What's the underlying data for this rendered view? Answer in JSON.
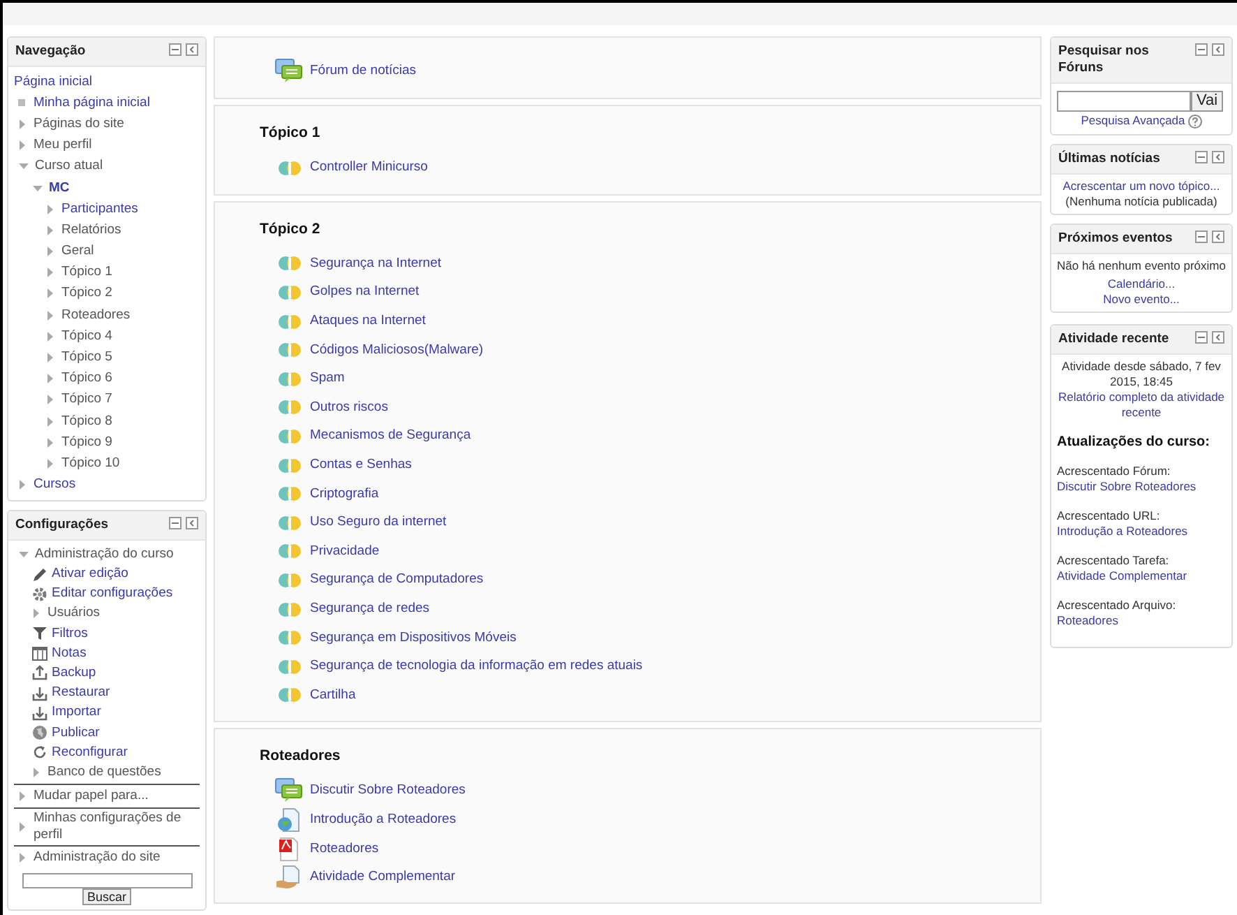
{
  "navigation": {
    "title": "Navegação",
    "items": [
      {
        "label": "Página inicial",
        "kind": "plain",
        "link": true
      },
      {
        "label": "Minha página inicial",
        "kind": "bullet",
        "link": true
      },
      {
        "label": "Páginas do site",
        "kind": "collapsed",
        "link": false
      },
      {
        "label": "Meu perfil",
        "kind": "collapsed",
        "link": false
      },
      {
        "label": "Curso atual",
        "kind": "expanded",
        "link": false,
        "children": [
          {
            "label": "MC",
            "kind": "course",
            "link": true,
            "children": [
              {
                "label": "Participantes",
                "kind": "collapsed",
                "link": true
              },
              {
                "label": "Relatórios",
                "kind": "collapsed",
                "link": false
              },
              {
                "label": "Geral",
                "kind": "collapsed",
                "link": false
              },
              {
                "label": "Tópico 1",
                "kind": "collapsed",
                "link": false
              },
              {
                "label": "Tópico 2",
                "kind": "collapsed",
                "link": false
              },
              {
                "label": "Roteadores",
                "kind": "collapsed",
                "link": false
              },
              {
                "label": "Tópico 4",
                "kind": "collapsed",
                "link": false
              },
              {
                "label": "Tópico 5",
                "kind": "collapsed",
                "link": false
              },
              {
                "label": "Tópico 6",
                "kind": "collapsed",
                "link": false
              },
              {
                "label": "Tópico 7",
                "kind": "collapsed",
                "link": false
              },
              {
                "label": "Tópico 8",
                "kind": "collapsed",
                "link": false
              },
              {
                "label": "Tópico 9",
                "kind": "collapsed",
                "link": false
              },
              {
                "label": "Tópico 10",
                "kind": "collapsed",
                "link": false
              }
            ]
          }
        ]
      },
      {
        "label": "Cursos",
        "kind": "collapsed",
        "link": true
      }
    ]
  },
  "settings": {
    "title": "Configurações",
    "groups": [
      {
        "label": "Administração do curso",
        "kind": "expanded",
        "link": false,
        "children": [
          {
            "label": "Ativar edição",
            "kind": "edit",
            "link": true
          },
          {
            "label": "Editar configurações",
            "kind": "settings",
            "link": true
          },
          {
            "label": "Usuários",
            "kind": "collapsed",
            "link": false
          },
          {
            "label": "Filtros",
            "kind": "filter",
            "link": true
          },
          {
            "label": "Notas",
            "kind": "grades",
            "link": true
          },
          {
            "label": "Backup",
            "kind": "upload",
            "link": true
          },
          {
            "label": "Restaurar",
            "kind": "download",
            "link": true
          },
          {
            "label": "Importar",
            "kind": "download",
            "link": true
          },
          {
            "label": "Publicar",
            "kind": "globe",
            "link": true
          },
          {
            "label": "Reconfigurar",
            "kind": "reset",
            "link": true
          },
          {
            "label": "Banco de questões",
            "kind": "collapsed",
            "link": false
          }
        ]
      },
      {
        "label": "Mudar papel para...",
        "kind": "collapsed",
        "link": false
      },
      {
        "label": "Minhas configurações de perfil",
        "kind": "collapsed",
        "link": false
      },
      {
        "label": "Administração do site",
        "kind": "collapsed",
        "link": false
      }
    ],
    "search_button": "Buscar"
  },
  "sections": [
    {
      "activities": [
        {
          "label": "Fórum de notícias",
          "kind": "forum"
        }
      ]
    },
    {
      "title": "Tópico 1",
      "activities": [
        {
          "label": "Controller Minicurso",
          "kind": "lesson"
        }
      ]
    },
    {
      "title": "Tópico 2",
      "activities": [
        {
          "label": "Segurança na Internet",
          "kind": "lesson"
        },
        {
          "label": "Golpes na Internet",
          "kind": "lesson"
        },
        {
          "label": "Ataques na Internet",
          "kind": "lesson"
        },
        {
          "label": "Códigos Maliciosos(Malware)",
          "kind": "lesson"
        },
        {
          "label": "Spam",
          "kind": "lesson"
        },
        {
          "label": "Outros riscos",
          "kind": "lesson"
        },
        {
          "label": "Mecanismos de Segurança",
          "kind": "lesson"
        },
        {
          "label": "Contas e Senhas",
          "kind": "lesson"
        },
        {
          "label": "Criptografia",
          "kind": "lesson"
        },
        {
          "label": "Uso Seguro da internet",
          "kind": "lesson"
        },
        {
          "label": "Privacidade",
          "kind": "lesson"
        },
        {
          "label": "Segurança de Computadores",
          "kind": "lesson"
        },
        {
          "label": "Segurança de redes",
          "kind": "lesson"
        },
        {
          "label": "Segurança em Dispositivos Móveis",
          "kind": "lesson"
        },
        {
          "label": "Segurança de tecnologia da informação em redes atuais",
          "kind": "lesson"
        },
        {
          "label": "Cartilha",
          "kind": "lesson"
        }
      ]
    },
    {
      "title": "Roteadores",
      "activities": [
        {
          "label": "Discutir Sobre Roteadores",
          "kind": "forum"
        },
        {
          "label": "Introdução a Roteadores",
          "kind": "url"
        },
        {
          "label": "Roteadores",
          "kind": "pdf"
        },
        {
          "label": "Atividade Complementar",
          "kind": "assign"
        }
      ]
    }
  ],
  "search_forums": {
    "title": "Pesquisar nos Fóruns",
    "button": "Vai",
    "advanced_link": "Pesquisa Avançada"
  },
  "latest_news": {
    "title": "Últimas notícias",
    "add_link": "Acrescentar um novo tópico...",
    "empty": "(Nenhuma notícia publicada)"
  },
  "upcoming_events": {
    "title": "Próximos eventos",
    "empty": "Não há nenhum evento próximo",
    "links": [
      "Calendário...",
      "Novo evento..."
    ]
  },
  "recent_activity": {
    "title": "Atividade recente",
    "since": "Atividade desde sábado, 7 fev 2015, 18:45",
    "report_link": "Relatório completo da atividade recente",
    "heading": "Atualizações do curso:",
    "updates": [
      {
        "label": "Acrescentado Fórum:",
        "link": "Discutir Sobre Roteadores"
      },
      {
        "label": "Acrescentado URL:",
        "link": "Introdução a Roteadores"
      },
      {
        "label": "Acrescentado Tarefa:",
        "link": "Atividade Complementar"
      },
      {
        "label": "Acrescentado Arquivo:",
        "link": "Roteadores"
      }
    ]
  }
}
